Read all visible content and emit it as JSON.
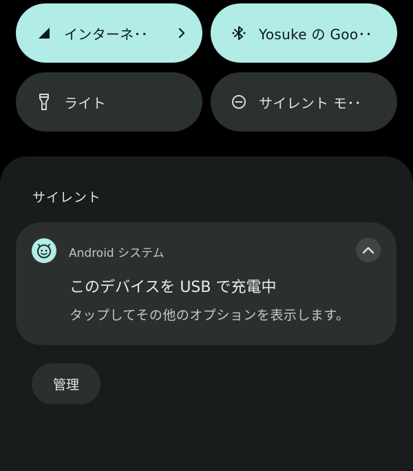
{
  "quick_settings": {
    "tiles": [
      {
        "label": "インターネ･･",
        "icon": "cellular-signal-icon",
        "has_chevron": true,
        "active": true
      },
      {
        "label": "Yosuke の Goo･･",
        "icon": "bluetooth-icon",
        "has_chevron": false,
        "active": true
      },
      {
        "label": "ライト",
        "icon": "flashlight-icon",
        "has_chevron": false,
        "active": false
      },
      {
        "label": "サイレント モ･･",
        "icon": "do-not-disturb-icon",
        "has_chevron": false,
        "active": false
      }
    ]
  },
  "notifications": {
    "section_label": "サイレント",
    "items": [
      {
        "app_name": "Android システム",
        "app_icon": "android-system-icon",
        "title": "このデバイスを USB で充電中",
        "text": "タップしてその他のオプションを表示します。",
        "expand_icon": "chevron-up-icon"
      }
    ],
    "manage_label": "管理"
  },
  "colors": {
    "background": "#000000",
    "active_tile": "#b1ece6",
    "inactive_tile": "#2b3130",
    "shade": "#191c1c",
    "card": "#2b302f"
  }
}
